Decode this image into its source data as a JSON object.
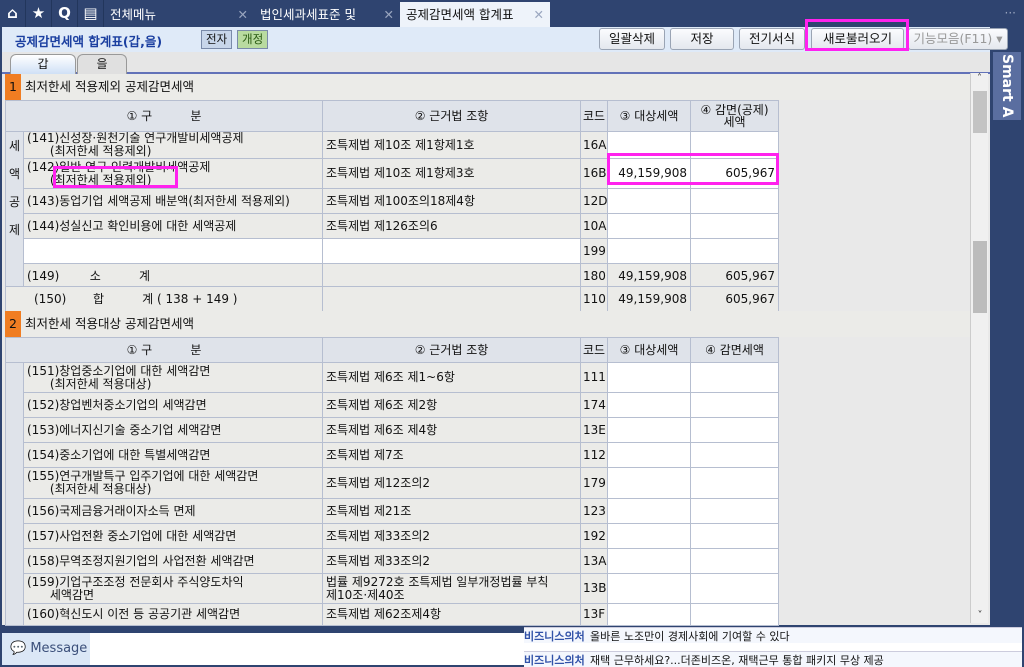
{
  "topbar": {
    "menu_label": "전체메뉴",
    "tabs": [
      {
        "label": "법인세과세표준 및"
      },
      {
        "label": "공제감면세액 합계표"
      }
    ],
    "more": "···"
  },
  "header": {
    "title": "공제감면세액 합계표(갑,을)",
    "badge1": "전자",
    "badge2": "개정",
    "buttons": [
      "일괄삭제",
      "저장",
      "전기서식",
      "새로불러오기",
      "기능모음(F11) ▾"
    ]
  },
  "subtabs": [
    "갑",
    "을"
  ],
  "section1": {
    "num": "1",
    "title": "최저한세 적용제외 공제감면세액",
    "headers": [
      "① 구          분",
      "② 근거법 조항",
      "코드",
      "③ 대상세액",
      "④ 감면(공제)\n세액"
    ],
    "side_label": [
      "세",
      "액",
      "공",
      "제"
    ],
    "rows": [
      {
        "name": "(141)신성장·원천기술 연구개발비세액공제\n      (최저한세 적용제외)",
        "law": "조특제법 제10조 제1항제1호",
        "code": "16A",
        "target": "",
        "amount": ""
      },
      {
        "name": "(142)일반 연구·인력개발비세액공제\n      (최저한세 적용제외)",
        "law": "조특제법 제10조 제1항제3호",
        "code": "16B",
        "target": "49,159,908",
        "amount": "605,967"
      },
      {
        "name": "(143)동업기업 세액공제 배분액(최저한세 적용제외)",
        "law": "조특제법 제100조의18제4항",
        "code": "12D",
        "target": "",
        "amount": ""
      },
      {
        "name": "(144)성실신고 확인비용에 대한 세액공제",
        "law": "조특제법 제126조의6",
        "code": "10A",
        "target": "",
        "amount": ""
      },
      {
        "name": "",
        "law": "",
        "code": "199",
        "target": "",
        "amount": ""
      },
      {
        "name": "(149)        소          계",
        "law": "",
        "code": "180",
        "target": "49,159,908",
        "amount": "605,967"
      }
    ],
    "total": {
      "name": "(150)       합          계 ( 138 + 149 )",
      "code": "110",
      "target": "49,159,908",
      "amount": "605,967"
    }
  },
  "section2": {
    "num": "2",
    "title": "최저한세 적용대상 공제감면세액",
    "headers": [
      "① 구          분",
      "② 근거법 조항",
      "코드",
      "③ 대상세액",
      "④ 감면세액"
    ],
    "rows": [
      {
        "name": "(151)창업중소기업에 대한 세액감면\n      (최저한세 적용대상)",
        "law": "조특제법 제6조 제1~6항",
        "code": "111"
      },
      {
        "name": "(152)창업벤처중소기업의 세액감면",
        "law": "조특제법 제6조 제2항",
        "code": "174"
      },
      {
        "name": "(153)에너지신기술 중소기업 세액감면",
        "law": "조특제법 제6조 제4항",
        "code": "13E"
      },
      {
        "name": "(154)중소기업에 대한 특별세액감면",
        "law": "조특제법 제7조",
        "code": "112"
      },
      {
        "name": "(155)연구개발특구 입주기업에 대한 세액감면\n      (최저한세 적용대상)",
        "law": "조특제법 제12조의2",
        "code": "179"
      },
      {
        "name": "(156)국제금융거래이자소득 면제",
        "law": "조특제법 제21조",
        "code": "123"
      },
      {
        "name": "(157)사업전환 중소기업에 대한 세액감면",
        "law": "조특제법 제33조의2",
        "code": "192"
      },
      {
        "name": "(158)무역조정지원기업의 사업전환 세액감면",
        "law": "조특제법 제33조의2",
        "code": "13A"
      },
      {
        "name": "(159)기업구조조정 전문회사 주식양도차익\n      세액감면",
        "law": "법률 제9272호 조특제법 일부개정법률 부칙\n제10조·제40조",
        "code": "13B"
      },
      {
        "name": "(160)혁신도시 이전 등 공공기관 세액감면",
        "law": "조특제법 제62조제4항",
        "code": "13F"
      }
    ]
  },
  "smart": "Smart A",
  "bottom": {
    "message": "Message",
    "news": [
      {
        "tag": "비즈니스의처",
        "text": "올바른 노조만이 경제사회에 기여할 수 있다"
      },
      {
        "tag": "비즈니스의처",
        "text": "재택 근무하세요?...더존비즈온, 재택근무 통합 패키지 무상 제공"
      }
    ]
  }
}
